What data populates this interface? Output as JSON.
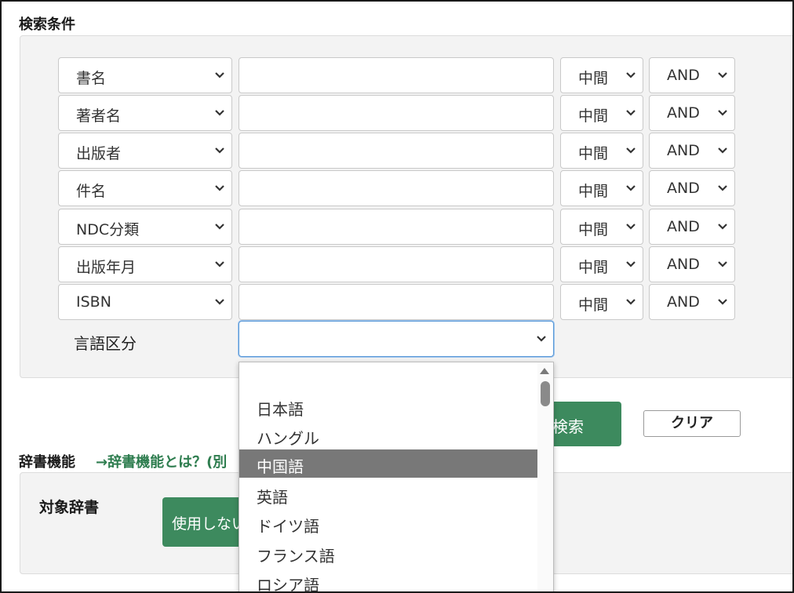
{
  "search_section": {
    "title": "検索条件",
    "rows": [
      {
        "field": "書名",
        "match": "中間",
        "op": "AND"
      },
      {
        "field": "著者名",
        "match": "中間",
        "op": "AND"
      },
      {
        "field": "出版者",
        "match": "中間",
        "op": "AND"
      },
      {
        "field": "件名",
        "match": "中間",
        "op": "AND"
      },
      {
        "field": "NDC分類",
        "match": "中間",
        "op": "AND"
      },
      {
        "field": "出版年月",
        "match": "中間",
        "op": "AND"
      },
      {
        "field": "ISBN",
        "match": "中間",
        "op": "AND"
      }
    ],
    "language_label": "言語区分",
    "language_value": ""
  },
  "buttons": {
    "search_label": "検索",
    "clear_label": "クリア"
  },
  "dictionary": {
    "title": "辞書機能",
    "link_text": "→辞書機能とは？(別",
    "target_label": "対象辞書",
    "no_use_label": "使用しない"
  },
  "language_dropdown": {
    "options": [
      "",
      "日本語",
      "ハングル",
      "中国語",
      "英語",
      "ドイツ語",
      "フランス語",
      "ロシア語"
    ],
    "highlighted": "中国語"
  },
  "icons": {
    "select_arrow": "chevron-down-icon",
    "scroll_up": "scroll-up-arrow-icon"
  },
  "colors": {
    "green_button": "#3d8a5e",
    "link_green": "#2e7d4f",
    "highlight_option": "#787878",
    "focus_border": "#5b9ad8"
  }
}
